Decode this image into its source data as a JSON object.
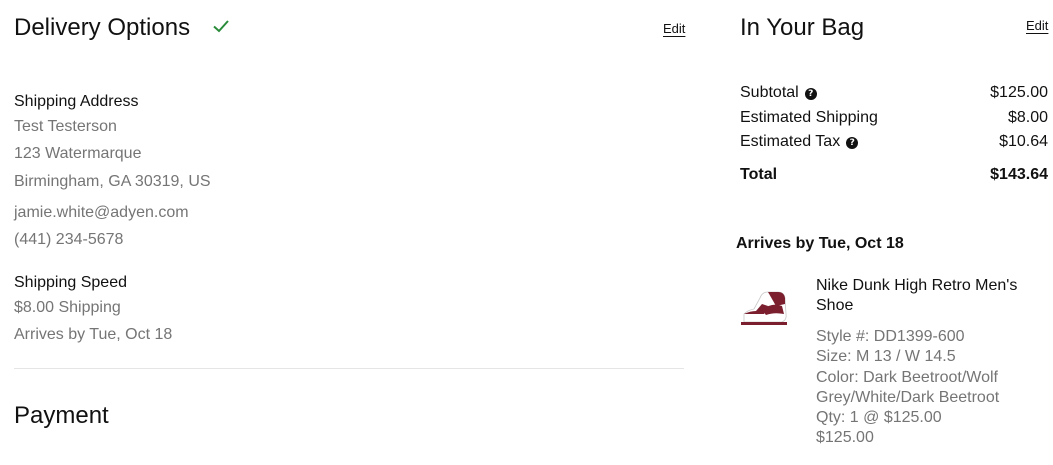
{
  "delivery": {
    "title": "Delivery Options",
    "edit_label": "Edit",
    "shipping_address_label": "Shipping Address",
    "name": "Test Testerson",
    "street": "123 Watermarque",
    "city_line": "Birmingham, GA 30319, US",
    "email": "jamie.white@adyen.com",
    "phone": "(441) 234-5678",
    "shipping_speed_label": "Shipping Speed",
    "shipping_cost": "$8.00 Shipping",
    "arrival": "Arrives by Tue, Oct 18"
  },
  "payment": {
    "title": "Payment"
  },
  "bag": {
    "title": "In Your Bag",
    "edit_label": "Edit",
    "subtotal_label": "Subtotal",
    "subtotal_value": "$125.00",
    "shipping_label": "Estimated Shipping",
    "shipping_value": "$8.00",
    "tax_label": "Estimated Tax",
    "tax_value": "$10.64",
    "total_label": "Total",
    "total_value": "$143.64",
    "help_glyph": "?",
    "arrives_heading": "Arrives by Tue, Oct 18",
    "item": {
      "name": "Nike Dunk High Retro Men's Shoe",
      "style": "Style #: DD1399-600",
      "size": "Size: M 13 / W 14.5",
      "color": "Color: Dark Beetroot/Wolf Grey/White/Dark Beetroot",
      "qty": "Qty: 1 @ $125.00",
      "price": "$125.00"
    }
  },
  "colors": {
    "check": "#2a8b3a",
    "muted_text": "#757575",
    "shoe": "#7b1f2e"
  }
}
